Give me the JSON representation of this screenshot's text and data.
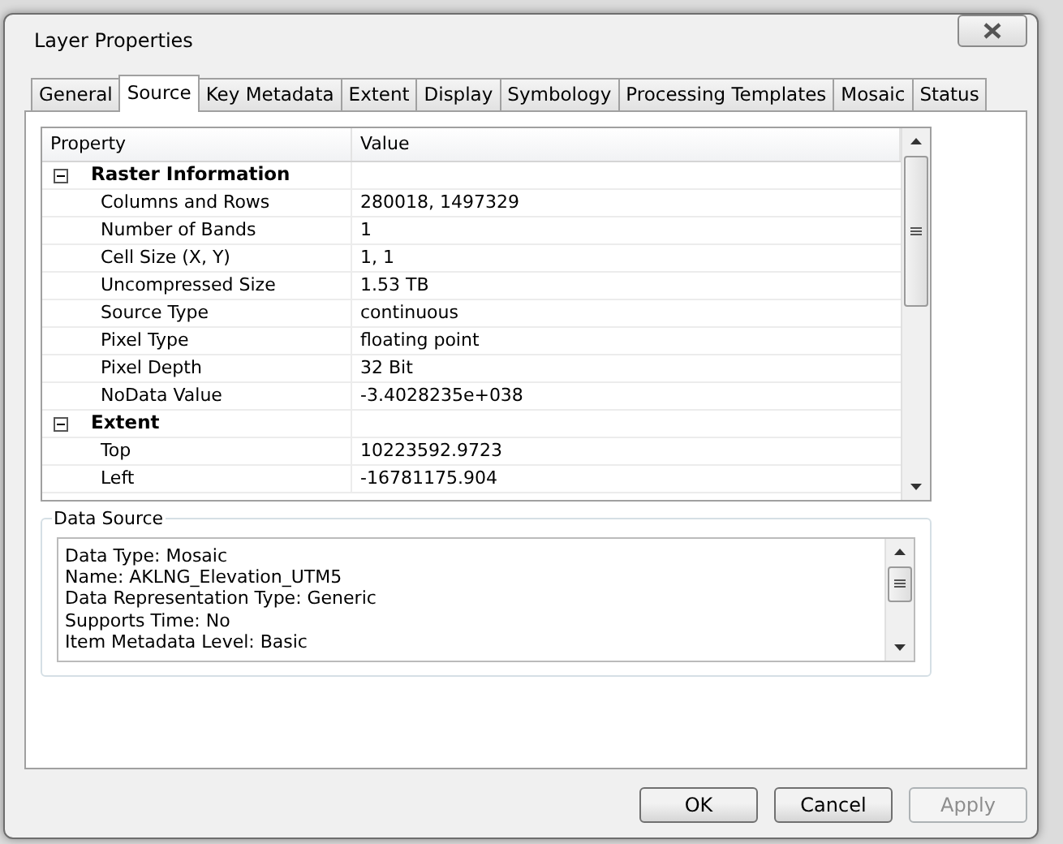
{
  "window": {
    "title": "Layer Properties"
  },
  "tabs": [
    {
      "label": "General",
      "selected": false
    },
    {
      "label": "Source",
      "selected": true
    },
    {
      "label": "Key Metadata",
      "selected": false
    },
    {
      "label": "Extent",
      "selected": false
    },
    {
      "label": "Display",
      "selected": false
    },
    {
      "label": "Symbology",
      "selected": false
    },
    {
      "label": "Processing Templates",
      "selected": false
    },
    {
      "label": "Mosaic",
      "selected": false
    },
    {
      "label": "Status",
      "selected": false
    }
  ],
  "property_grid": {
    "columns": [
      "Property",
      "Value"
    ],
    "groups": [
      {
        "title": "Raster Information",
        "expanded": true,
        "rows": [
          {
            "property": "Columns and Rows",
            "value": "280018, 1497329"
          },
          {
            "property": "Number of Bands",
            "value": "1"
          },
          {
            "property": "Cell Size (X, Y)",
            "value": "1, 1"
          },
          {
            "property": "Uncompressed Size",
            "value": "1.53 TB"
          },
          {
            "property": "Source Type",
            "value": "continuous"
          },
          {
            "property": "Pixel Type",
            "value": "floating point"
          },
          {
            "property": "Pixel Depth",
            "value": "32 Bit"
          },
          {
            "property": "NoData Value",
            "value": "-3.4028235e+038"
          }
        ]
      },
      {
        "title": "Extent",
        "expanded": true,
        "rows": [
          {
            "property": "Top",
            "value": "10223592.9723"
          },
          {
            "property": "Left",
            "value": "-16781175.904"
          }
        ]
      }
    ]
  },
  "data_source": {
    "title": "Data Source",
    "lines": [
      "Data Type: Mosaic",
      "Name: AKLNG_Elevation_UTM5",
      "Data Representation Type: Generic",
      "Supports Time: No",
      "Item Metadata Level: Basic"
    ]
  },
  "buttons": [
    {
      "label": "OK",
      "disabled": false
    },
    {
      "label": "Cancel",
      "disabled": false
    },
    {
      "label": "Apply",
      "disabled": true
    }
  ]
}
